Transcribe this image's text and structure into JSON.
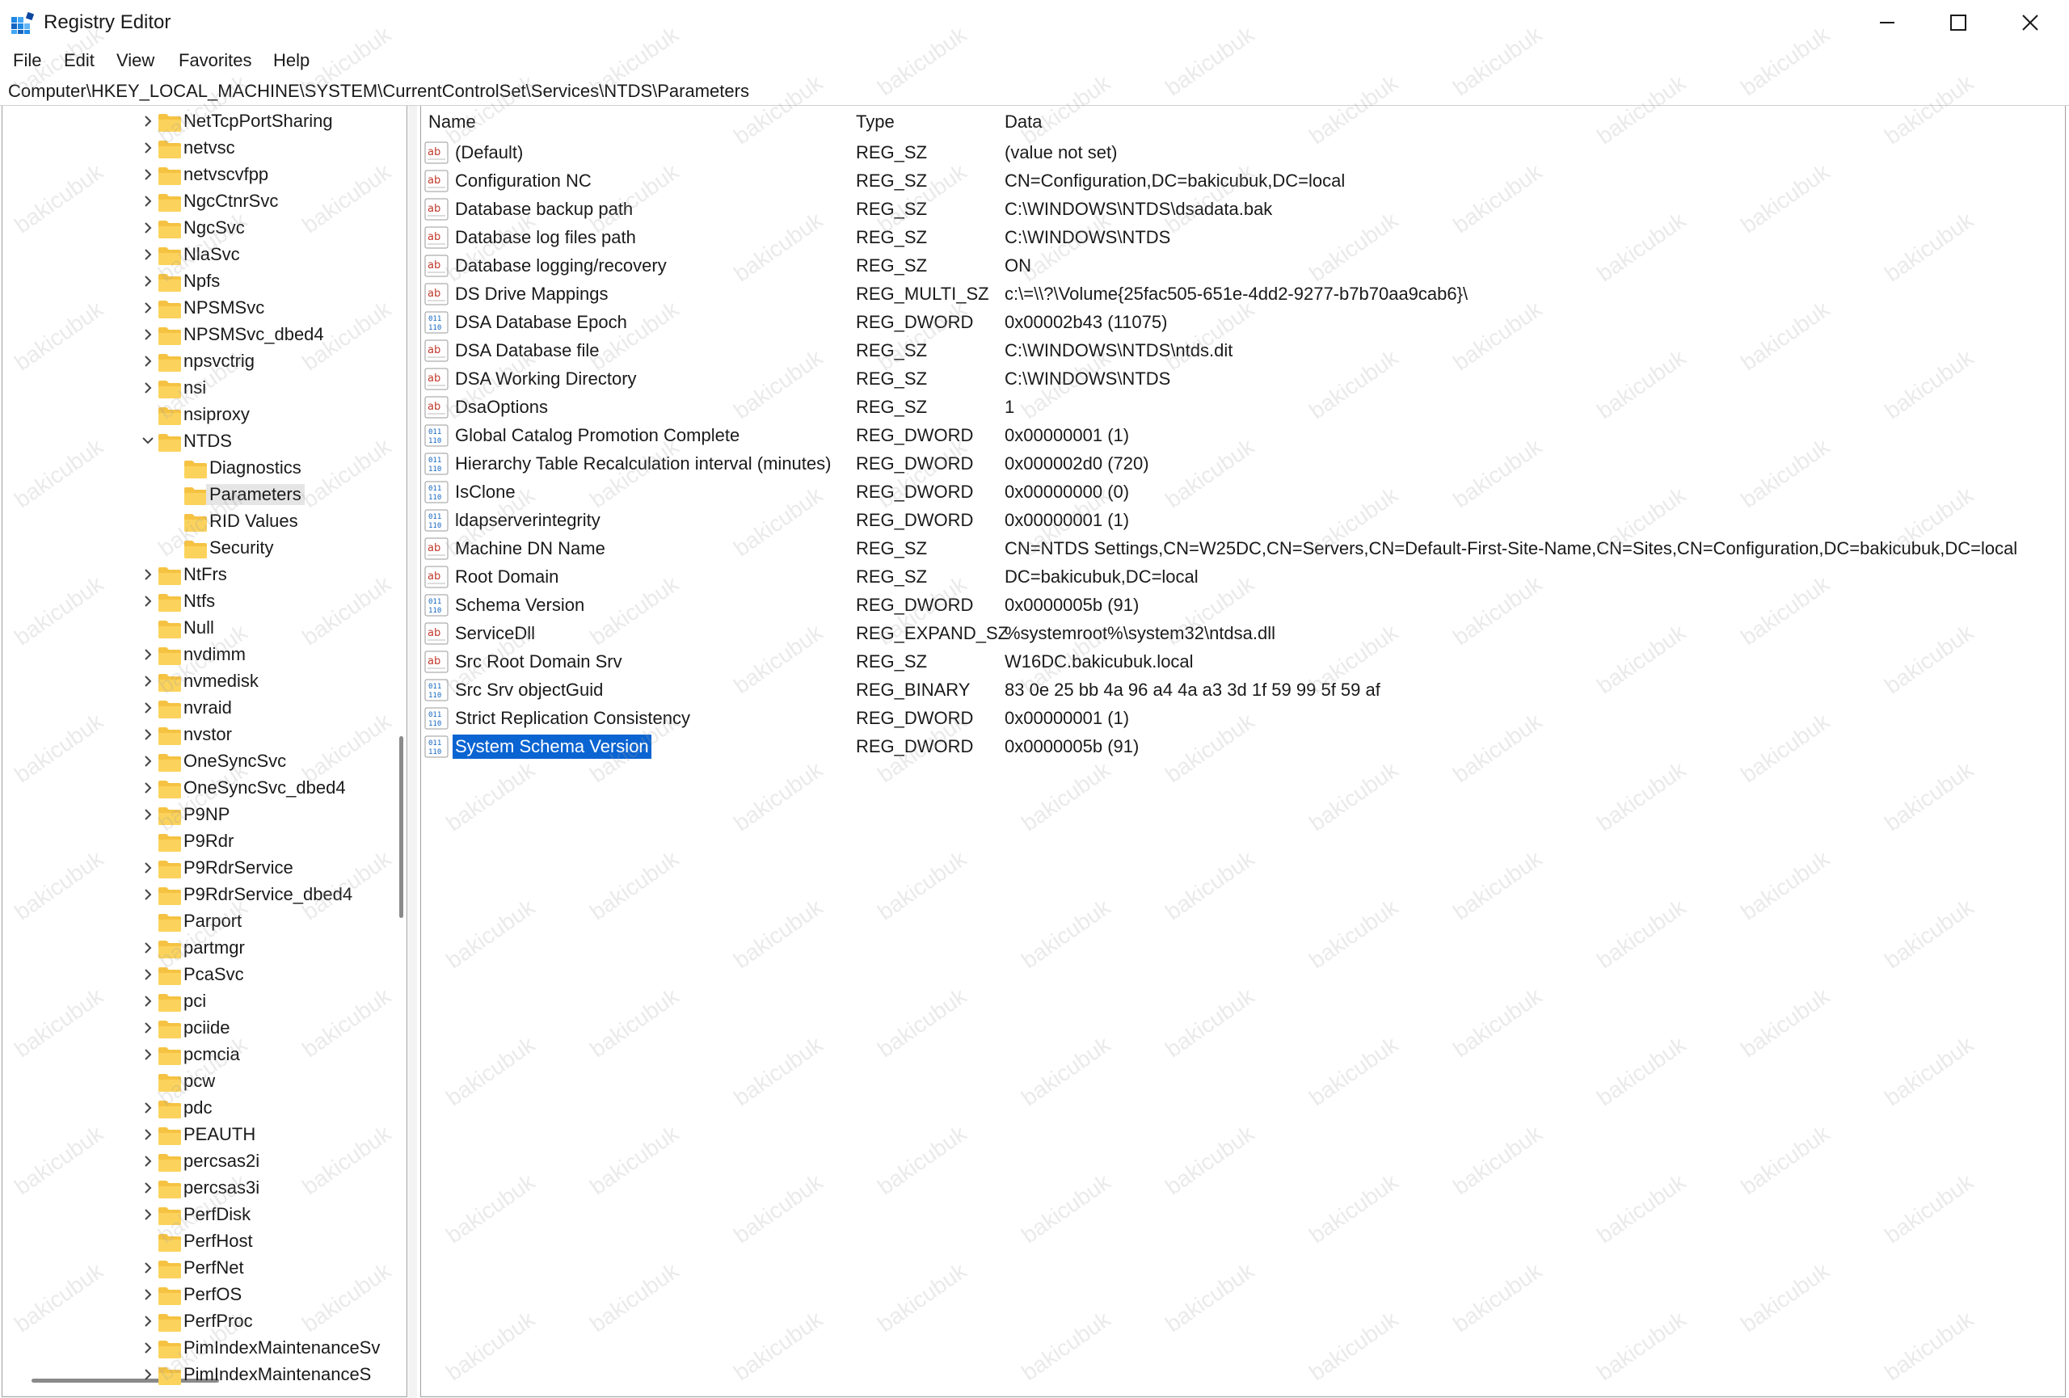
{
  "window": {
    "title": "Registry Editor"
  },
  "menu": [
    "File",
    "Edit",
    "View",
    "Favorites",
    "Help"
  ],
  "address": "Computer\\HKEY_LOCAL_MACHINE\\SYSTEM\\CurrentControlSet\\Services\\NTDS\\Parameters",
  "tree": [
    {
      "label": "NetTcpPortSharing",
      "chevron": "right",
      "depth": 0
    },
    {
      "label": "netvsc",
      "chevron": "right",
      "depth": 0
    },
    {
      "label": "netvscvfpp",
      "chevron": "right",
      "depth": 0
    },
    {
      "label": "NgcCtnrSvc",
      "chevron": "right",
      "depth": 0
    },
    {
      "label": "NgcSvc",
      "chevron": "right",
      "depth": 0
    },
    {
      "label": "NlaSvc",
      "chevron": "right",
      "depth": 0
    },
    {
      "label": "Npfs",
      "chevron": "right",
      "depth": 0
    },
    {
      "label": "NPSMSvc",
      "chevron": "right",
      "depth": 0
    },
    {
      "label": "NPSMSvc_dbed4",
      "chevron": "right",
      "depth": 0
    },
    {
      "label": "npsvctrig",
      "chevron": "right",
      "depth": 0
    },
    {
      "label": "nsi",
      "chevron": "right",
      "depth": 0
    },
    {
      "label": "nsiproxy",
      "chevron": "none",
      "depth": 0
    },
    {
      "label": "NTDS",
      "chevron": "down",
      "depth": 0
    },
    {
      "label": "Diagnostics",
      "chevron": "none",
      "depth": 1
    },
    {
      "label": "Parameters",
      "chevron": "none",
      "depth": 1,
      "selected": true
    },
    {
      "label": "RID Values",
      "chevron": "none",
      "depth": 1
    },
    {
      "label": "Security",
      "chevron": "none",
      "depth": 1
    },
    {
      "label": "NtFrs",
      "chevron": "right",
      "depth": 0
    },
    {
      "label": "Ntfs",
      "chevron": "right",
      "depth": 0
    },
    {
      "label": "Null",
      "chevron": "none",
      "depth": 0
    },
    {
      "label": "nvdimm",
      "chevron": "right",
      "depth": 0
    },
    {
      "label": "nvmedisk",
      "chevron": "right",
      "depth": 0
    },
    {
      "label": "nvraid",
      "chevron": "right",
      "depth": 0
    },
    {
      "label": "nvstor",
      "chevron": "right",
      "depth": 0
    },
    {
      "label": "OneSyncSvc",
      "chevron": "right",
      "depth": 0
    },
    {
      "label": "OneSyncSvc_dbed4",
      "chevron": "right",
      "depth": 0
    },
    {
      "label": "P9NP",
      "chevron": "right",
      "depth": 0
    },
    {
      "label": "P9Rdr",
      "chevron": "none",
      "depth": 0
    },
    {
      "label": "P9RdrService",
      "chevron": "right",
      "depth": 0
    },
    {
      "label": "P9RdrService_dbed4",
      "chevron": "right",
      "depth": 0
    },
    {
      "label": "Parport",
      "chevron": "none",
      "depth": 0
    },
    {
      "label": "partmgr",
      "chevron": "right",
      "depth": 0
    },
    {
      "label": "PcaSvc",
      "chevron": "right",
      "depth": 0
    },
    {
      "label": "pci",
      "chevron": "right",
      "depth": 0
    },
    {
      "label": "pciide",
      "chevron": "right",
      "depth": 0
    },
    {
      "label": "pcmcia",
      "chevron": "right",
      "depth": 0
    },
    {
      "label": "pcw",
      "chevron": "none",
      "depth": 0
    },
    {
      "label": "pdc",
      "chevron": "right",
      "depth": 0
    },
    {
      "label": "PEAUTH",
      "chevron": "right",
      "depth": 0
    },
    {
      "label": "percsas2i",
      "chevron": "right",
      "depth": 0
    },
    {
      "label": "percsas3i",
      "chevron": "right",
      "depth": 0
    },
    {
      "label": "PerfDisk",
      "chevron": "right",
      "depth": 0
    },
    {
      "label": "PerfHost",
      "chevron": "none",
      "depth": 0
    },
    {
      "label": "PerfNet",
      "chevron": "right",
      "depth": 0
    },
    {
      "label": "PerfOS",
      "chevron": "right",
      "depth": 0
    },
    {
      "label": "PerfProc",
      "chevron": "right",
      "depth": 0
    },
    {
      "label": "PimIndexMaintenanceSv",
      "chevron": "right",
      "depth": 0
    },
    {
      "label": "PimIndexMaintenanceS",
      "chevron": "right",
      "depth": 0
    }
  ],
  "columns": {
    "name": "Name",
    "type": "Type",
    "data": "Data"
  },
  "values": [
    {
      "name": "(Default)",
      "type": "REG_SZ",
      "data": "(value not set)",
      "icon": "string"
    },
    {
      "name": "Configuration NC",
      "type": "REG_SZ",
      "data": "CN=Configuration,DC=bakicubuk,DC=local",
      "icon": "string"
    },
    {
      "name": "Database backup path",
      "type": "REG_SZ",
      "data": "C:\\WINDOWS\\NTDS\\dsadata.bak",
      "icon": "string"
    },
    {
      "name": "Database log files path",
      "type": "REG_SZ",
      "data": "C:\\WINDOWS\\NTDS",
      "icon": "string"
    },
    {
      "name": "Database logging/recovery",
      "type": "REG_SZ",
      "data": "ON",
      "icon": "string"
    },
    {
      "name": "DS Drive Mappings",
      "type": "REG_MULTI_SZ",
      "data": "c:\\=\\\\?\\Volume{25fac505-651e-4dd2-9277-b7b70aa9cab6}\\",
      "icon": "string"
    },
    {
      "name": "DSA Database Epoch",
      "type": "REG_DWORD",
      "data": "0x00002b43 (11075)",
      "icon": "binary"
    },
    {
      "name": "DSA Database file",
      "type": "REG_SZ",
      "data": "C:\\WINDOWS\\NTDS\\ntds.dit",
      "icon": "string"
    },
    {
      "name": "DSA Working Directory",
      "type": "REG_SZ",
      "data": "C:\\WINDOWS\\NTDS",
      "icon": "string"
    },
    {
      "name": "DsaOptions",
      "type": "REG_SZ",
      "data": "1",
      "icon": "string"
    },
    {
      "name": "Global Catalog Promotion Complete",
      "type": "REG_DWORD",
      "data": "0x00000001 (1)",
      "icon": "binary"
    },
    {
      "name": "Hierarchy Table Recalculation interval (minutes)",
      "type": "REG_DWORD",
      "data": "0x000002d0 (720)",
      "icon": "binary"
    },
    {
      "name": "IsClone",
      "type": "REG_DWORD",
      "data": "0x00000000 (0)",
      "icon": "binary"
    },
    {
      "name": "ldapserverintegrity",
      "type": "REG_DWORD",
      "data": "0x00000001 (1)",
      "icon": "binary"
    },
    {
      "name": "Machine DN Name",
      "type": "REG_SZ",
      "data": "CN=NTDS Settings,CN=W25DC,CN=Servers,CN=Default-First-Site-Name,CN=Sites,CN=Configuration,DC=bakicubuk,DC=local",
      "icon": "string"
    },
    {
      "name": "Root Domain",
      "type": "REG_SZ",
      "data": "DC=bakicubuk,DC=local",
      "icon": "string"
    },
    {
      "name": "Schema Version",
      "type": "REG_DWORD",
      "data": "0x0000005b (91)",
      "icon": "binary"
    },
    {
      "name": "ServiceDll",
      "type": "REG_EXPAND_SZ",
      "data": "%systemroot%\\system32\\ntdsa.dll",
      "icon": "string"
    },
    {
      "name": "Src Root Domain Srv",
      "type": "REG_SZ",
      "data": "W16DC.bakicubuk.local",
      "icon": "string"
    },
    {
      "name": "Src Srv objectGuid",
      "type": "REG_BINARY",
      "data": "83 0e 25 bb 4a 96 a4 4a a3 3d 1f 59 99 5f 59 af",
      "icon": "binary"
    },
    {
      "name": "Strict Replication Consistency",
      "type": "REG_DWORD",
      "data": "0x00000001 (1)",
      "icon": "binary"
    },
    {
      "name": "System Schema Version",
      "type": "REG_DWORD",
      "data": "0x0000005b (91)",
      "icon": "binary",
      "selected": true
    }
  ],
  "watermark": "bakicubuk",
  "colors": {
    "selection": "#0a64d2",
    "folder": "#f5c242",
    "tree_selection": "#e5e5e5"
  }
}
